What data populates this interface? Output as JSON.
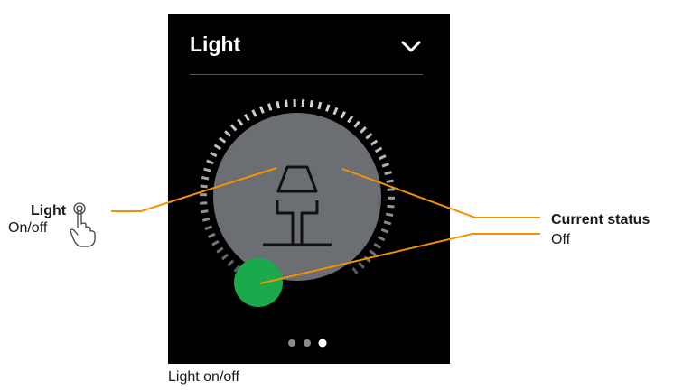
{
  "panel": {
    "title": "Light",
    "collapse_icon": "chevron-down-icon",
    "device_icon": "floor-lamp-icon",
    "status_indicator_color": "#1aaa4b",
    "background_color": "#000000",
    "dial_color": "#6b6e73",
    "page_count": 3,
    "active_page": 3
  },
  "callouts": {
    "left_title": "Light",
    "left_subtitle": "On/off",
    "left_icon": "touch-hand-icon",
    "right_title": "Current status",
    "right_value": "Off",
    "line_color": "#f39200"
  },
  "caption": "Light on/off"
}
